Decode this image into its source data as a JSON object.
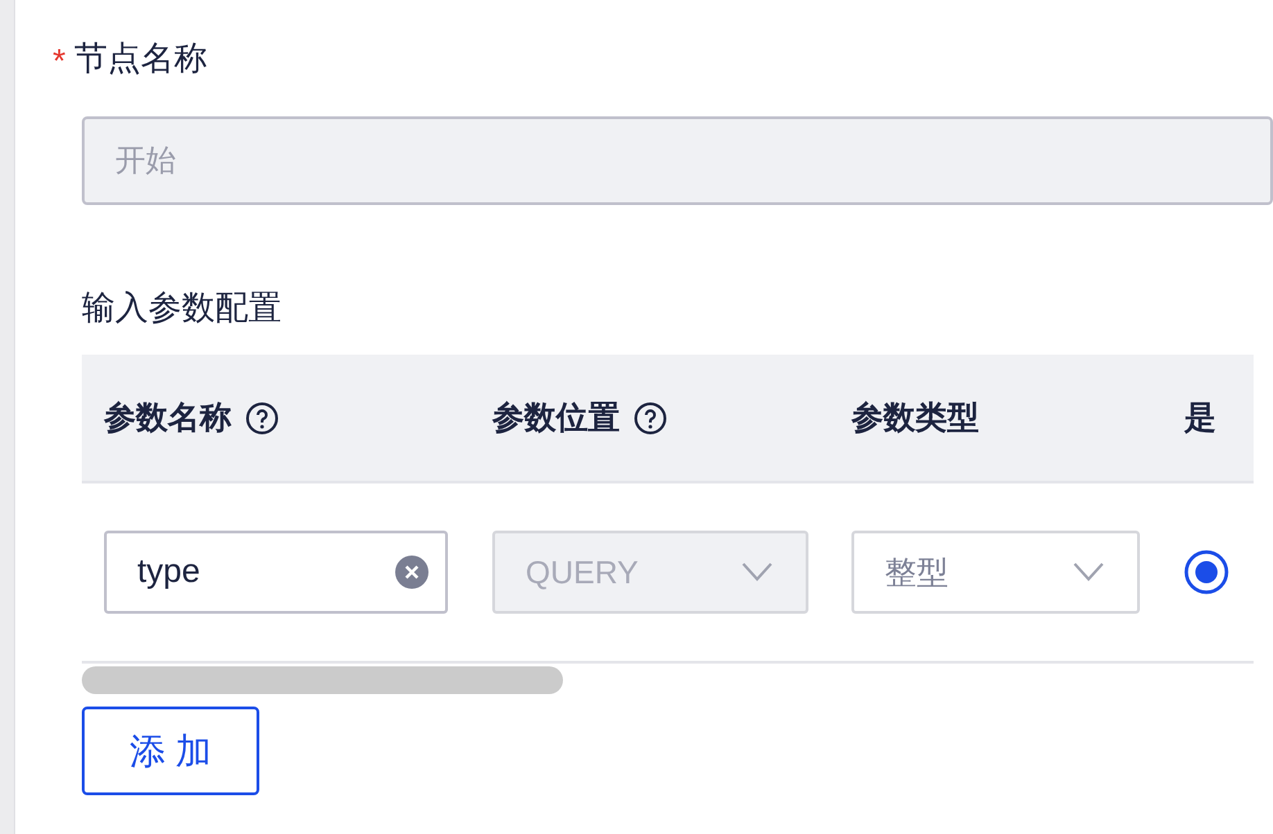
{
  "node_name": {
    "label": "节点名称",
    "required_mark": "*",
    "value": "开始",
    "disabled": true
  },
  "section_title": "输入参数配置",
  "table": {
    "columns": [
      {
        "label": "参数名称",
        "help": true
      },
      {
        "label": "参数位置",
        "help": true
      },
      {
        "label": "参数类型",
        "help": false
      },
      {
        "label": "是",
        "help": false
      }
    ],
    "rows": [
      {
        "cells": [
          {
            "kind": "input",
            "value": "type",
            "clearable": true,
            "disabled": false
          },
          {
            "kind": "select",
            "value": "QUERY",
            "disabled": true
          },
          {
            "kind": "select",
            "value": "整型",
            "disabled": false
          },
          {
            "kind": "radio",
            "selected": true
          }
        ]
      }
    ]
  },
  "add_button": "添 加"
}
